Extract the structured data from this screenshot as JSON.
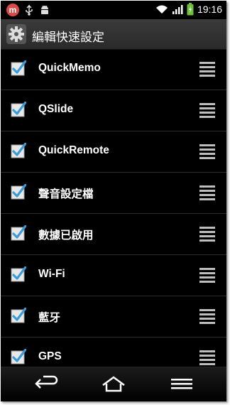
{
  "status_bar": {
    "time": "19:16",
    "icons": [
      "m-app-icon",
      "usb-icon",
      "android-icon",
      "wifi-icon",
      "signal-icon",
      "battery-charging-icon"
    ]
  },
  "title_bar": {
    "title": "編輯快速設定",
    "icon": "gear-icon"
  },
  "items": [
    {
      "label": "QuickMemo",
      "checked": true
    },
    {
      "label": "QSlide",
      "checked": true
    },
    {
      "label": "QuickRemote",
      "checked": true
    },
    {
      "label": "聲音設定檔",
      "checked": true
    },
    {
      "label": "數據已啟用",
      "checked": true
    },
    {
      "label": "Wi-Fi",
      "checked": true
    },
    {
      "label": "藍牙",
      "checked": true
    },
    {
      "label": "GPS",
      "checked": true
    }
  ],
  "nav_bar": {
    "buttons": [
      "back-icon",
      "home-icon",
      "menu-icon"
    ]
  },
  "colors": {
    "accent": "#3b9bd9",
    "background": "#000000",
    "text": "#ffffff"
  }
}
